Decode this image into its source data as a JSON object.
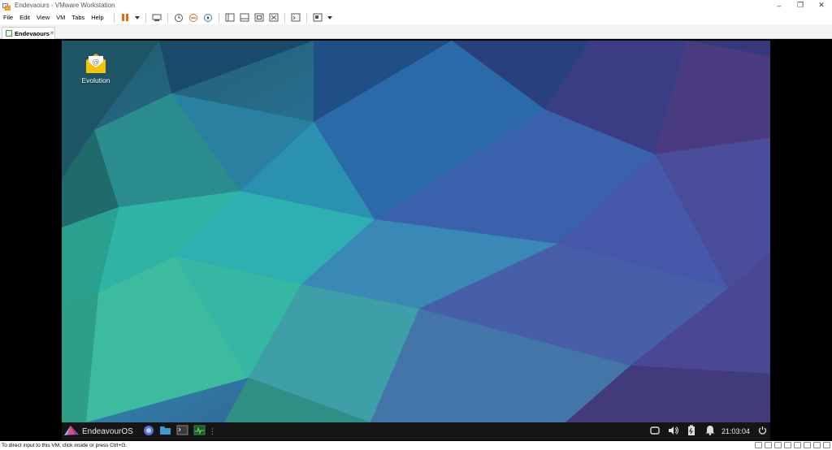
{
  "window": {
    "title": "Endevaours - VMware Workstation",
    "minimize": "–",
    "maximize": "❐",
    "close": "✕"
  },
  "menu": [
    "File",
    "Edit",
    "View",
    "VM",
    "Tabs",
    "Help"
  ],
  "toolbar": {
    "icons": [
      "pause-icon",
      "dropdown-arrow-icon",
      "send-ctrl-alt-del-icon",
      "snapshot-icon",
      "revert-snapshot-icon",
      "snapshot-manager-icon",
      "show-library-icon",
      "normal-view-icon",
      "full-screen-icon",
      "unity-icon",
      "console-view-icon",
      "stretch-view-icon"
    ]
  },
  "tab": {
    "label": "Endevaours",
    "close": "✕"
  },
  "desktop": {
    "icon_label": "Evolution"
  },
  "taskbar": {
    "os_name": "EndeavourOS",
    "clock": "21:03:04",
    "more": "⋮"
  },
  "statusbar": {
    "text": "To direct input to this VM, click inside or press Ctrl+G."
  },
  "colors": {
    "taskbar": "#151515",
    "vm_background": "#000000"
  }
}
